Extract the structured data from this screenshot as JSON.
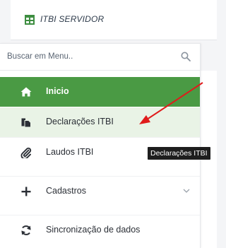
{
  "header": {
    "title": "ITBI SERVIDOR",
    "logo_icon": "table-icon",
    "logo_color": "#3e8e41"
  },
  "search": {
    "placeholder": "Buscar em Menu..",
    "icon": "search-icon"
  },
  "menu": {
    "items": [
      {
        "label": "Inicio",
        "icon": "home-icon",
        "active": true
      },
      {
        "label": "Declarações ITBI",
        "icon": "copy-icon",
        "hovered": true
      },
      {
        "label": "Laudos ITBI",
        "icon": "paperclip-icon"
      },
      {
        "label": "Cadastros",
        "icon": "plus-icon",
        "has_submenu": true
      },
      {
        "label": "Sincronização de dados",
        "icon": "sync-icon"
      }
    ]
  },
  "tooltip": {
    "text": "Declarações ITBI"
  },
  "colors": {
    "active_bg": "#4a9a44",
    "hover_bg": "#e9f3e6",
    "annotation_arrow": "#e01b1b"
  }
}
